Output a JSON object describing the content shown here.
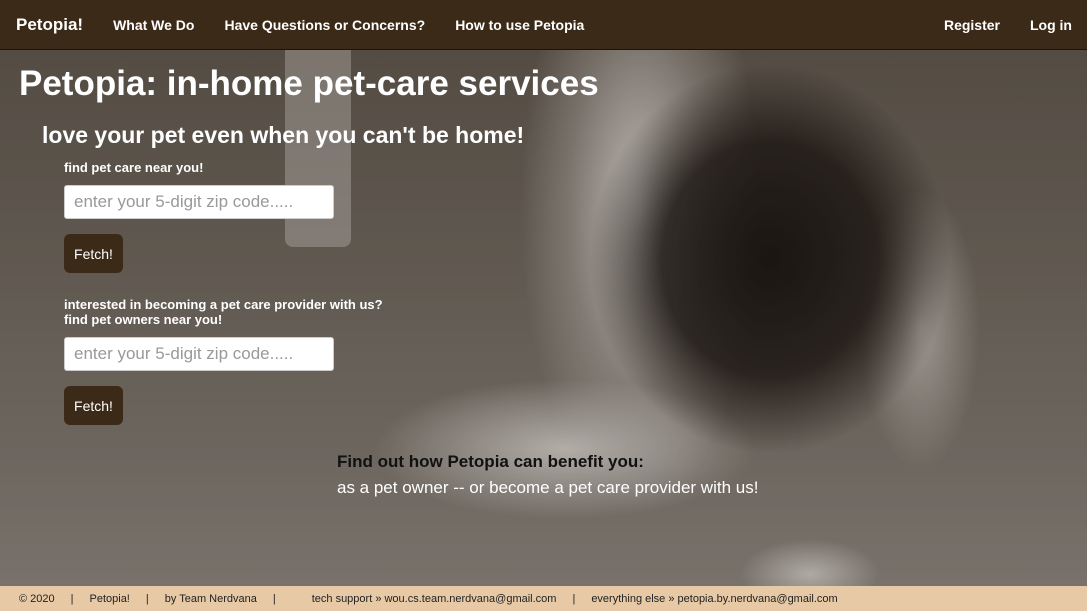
{
  "nav": {
    "brand": "Petopia!",
    "links": [
      "What We Do",
      "Have Questions or Concerns?",
      "How to use Petopia"
    ],
    "register": "Register",
    "login": "Log in"
  },
  "hero": {
    "title": "Petopia: in-home pet-care services",
    "subtitle": "love your pet even when you can't be home!"
  },
  "owner_search": {
    "label": "find pet care near you!",
    "placeholder": "enter your 5-digit zip code.....",
    "button": "Fetch!"
  },
  "provider_search": {
    "label_line1": "interested in becoming a pet care provider with us?",
    "label_line2": "find pet owners near you!",
    "placeholder": "enter your 5-digit zip code.....",
    "button": "Fetch!"
  },
  "benefit": {
    "title": "Find out how Petopia can benefit you:",
    "text": "as a pet owner -- or become a pet care provider with us!"
  },
  "footer": {
    "copyright": "© 2020",
    "site": "Petopia!",
    "team": "by Team Nerdvana",
    "support": "tech support » wou.cs.team.nerdvana@gmail.com",
    "other": "everything else » petopia.by.nerdvana@gmail.com",
    "separator": "|"
  },
  "colors": {
    "navbar": "#3b2a17",
    "button": "#3b2a17",
    "footer": "#e8c9a6"
  }
}
